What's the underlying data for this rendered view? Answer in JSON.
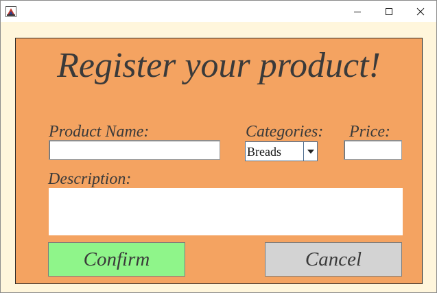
{
  "window": {
    "title": "",
    "controls": {
      "minimize_icon": "minimize-icon",
      "maximize_icon": "maximize-icon",
      "close_icon": "close-icon"
    }
  },
  "form": {
    "heading": "Register your product!",
    "product_name_label": "Product Name:",
    "product_name_value": "",
    "categories_label": "Categories:",
    "category_selected": "Breads",
    "price_label": "Price:",
    "price_value": "",
    "description_label": "Description:",
    "description_value": "",
    "confirm_label": "Confirm",
    "cancel_label": "Cancel"
  },
  "colors": {
    "panel_bg": "#f4a361",
    "window_bg": "#fff6dc",
    "confirm_bg": "#8ff58a",
    "cancel_bg": "#d3d3d3",
    "text": "#3a3a3a"
  }
}
